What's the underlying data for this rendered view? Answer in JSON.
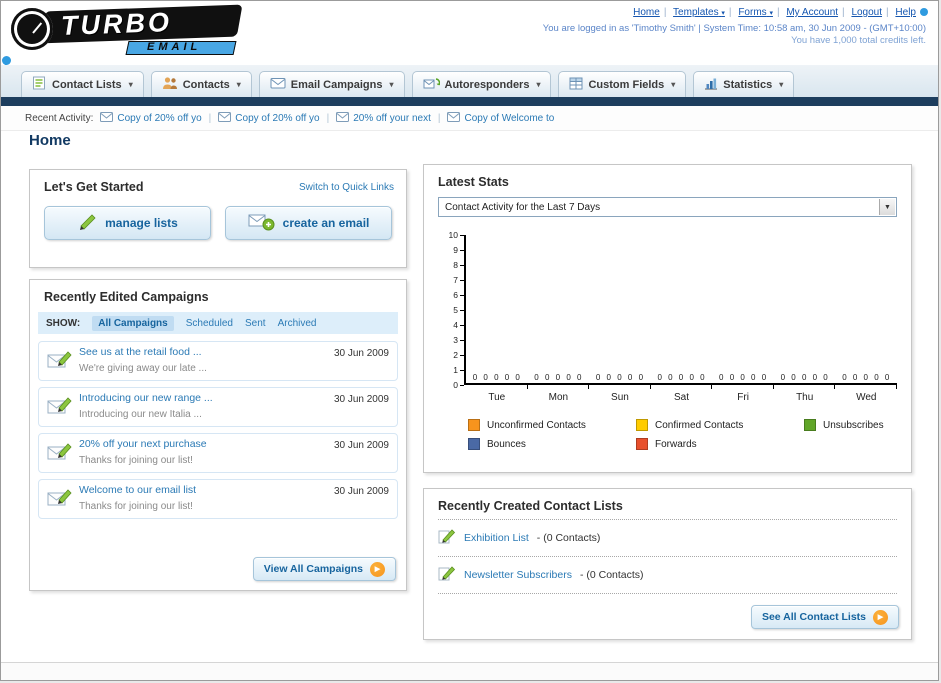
{
  "header": {
    "logo_title": "TURBO",
    "logo_subtitle": "EMAIL",
    "nav": [
      {
        "label": "Home"
      },
      {
        "label": "Templates"
      },
      {
        "label": "Forms"
      },
      {
        "label": "My Account"
      },
      {
        "label": "Logout"
      },
      {
        "label": "Help"
      }
    ],
    "login_status": "You are logged in as 'Timothy Smith' | System Time: 10:58 am, 30 Jun 2009 - (GMT+10:00)",
    "credits": "You have 1,000 total credits left."
  },
  "nav_tabs": [
    {
      "label": "Contact Lists"
    },
    {
      "label": "Contacts"
    },
    {
      "label": "Email Campaigns"
    },
    {
      "label": "Autoresponders"
    },
    {
      "label": "Custom Fields"
    },
    {
      "label": "Statistics"
    }
  ],
  "recent_activity": {
    "label": "Recent Activity:",
    "items": [
      {
        "label": "Copy of 20% off yo"
      },
      {
        "label": "Copy of 20% off yo"
      },
      {
        "label": "20% off your next"
      },
      {
        "label": "Copy of Welcome to"
      }
    ]
  },
  "page": {
    "title": "Home"
  },
  "get_started": {
    "title": "Let's Get Started",
    "switch_link": "Switch to Quick Links",
    "manage_lists_label": "manage lists",
    "create_email_label": "create an email"
  },
  "campaigns": {
    "title": "Recently Edited Campaigns",
    "show_label": "SHOW:",
    "filters": [
      {
        "label": "All Campaigns",
        "selected": true
      },
      {
        "label": "Scheduled",
        "selected": false
      },
      {
        "label": "Sent",
        "selected": false
      },
      {
        "label": "Archived",
        "selected": false
      }
    ],
    "items": [
      {
        "title": "See us at the retail food ...",
        "subtitle": "We're giving away our late ...",
        "date": "30 Jun 2009"
      },
      {
        "title": "Introducing our new range ...",
        "subtitle": "Introducing our new Italia ...",
        "date": "30 Jun 2009"
      },
      {
        "title": "20% off your next purchase",
        "subtitle": "Thanks for joining our list!",
        "date": "30 Jun 2009"
      },
      {
        "title": "Welcome to our email list",
        "subtitle": "Thanks for joining our list!",
        "date": "30 Jun 2009"
      }
    ],
    "view_all_label": "View All Campaigns"
  },
  "stats": {
    "title": "Latest Stats",
    "period_selector": "Contact Activity for the Last 7 Days",
    "chart_data": {
      "type": "bar",
      "title": "Contact Activity for the Last 7 Days",
      "categories": [
        "Tue",
        "Mon",
        "Sun",
        "Sat",
        "Fri",
        "Thu",
        "Wed"
      ],
      "series": [
        {
          "name": "Unconfirmed Contacts",
          "color": "#f7941d",
          "values": [
            0,
            0,
            0,
            0,
            0,
            0,
            0
          ]
        },
        {
          "name": "Confirmed Contacts",
          "color": "#ffcc00",
          "values": [
            0,
            0,
            0,
            0,
            0,
            0,
            0
          ]
        },
        {
          "name": "Unsubscribes",
          "color": "#61a628",
          "values": [
            0,
            0,
            0,
            0,
            0,
            0,
            0
          ]
        },
        {
          "name": "Bounces",
          "color": "#4a69a5",
          "values": [
            0,
            0,
            0,
            0,
            0,
            0,
            0
          ]
        },
        {
          "name": "Forwards",
          "color": "#e8502c",
          "values": [
            0,
            0,
            0,
            0,
            0,
            0,
            0
          ]
        }
      ],
      "ylim": [
        0,
        10
      ],
      "ytick_step": 1,
      "grid": false,
      "legend_position": "bottom",
      "xlabel": "",
      "ylabel": ""
    }
  },
  "contact_lists": {
    "title": "Recently Created Contact Lists",
    "items": [
      {
        "name": "Exhibition List",
        "detail": "- (0 Contacts)"
      },
      {
        "name": "Newsletter Subscribers",
        "detail": "- (0 Contacts)"
      }
    ],
    "see_all_label": "See All Contact Lists"
  },
  "colors": {
    "navy_bar": "#1d3e5e",
    "link_blue": "#2b7ab5",
    "accent_orange": "#f7941d"
  }
}
